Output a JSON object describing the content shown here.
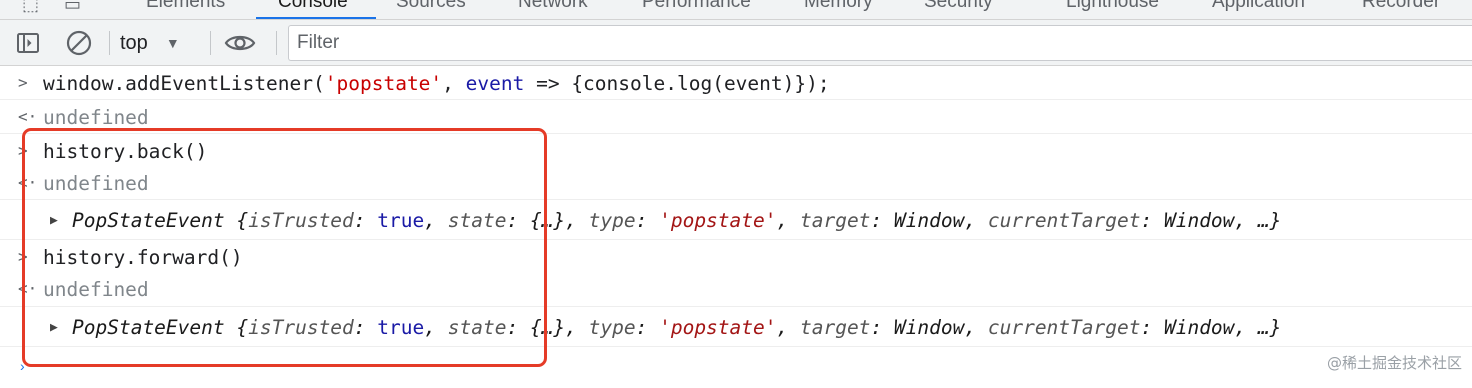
{
  "tabs": [
    {
      "label": "Elements",
      "active": false
    },
    {
      "label": "Console",
      "active": true
    },
    {
      "label": "Sources",
      "active": false
    },
    {
      "label": "Network",
      "active": false
    },
    {
      "label": "Performance",
      "active": false
    },
    {
      "label": "Memory",
      "active": false
    },
    {
      "label": "Security",
      "active": false
    },
    {
      "label": "Lighthouse",
      "active": false
    },
    {
      "label": "Application",
      "active": false
    },
    {
      "label": "Recorder",
      "active": false
    }
  ],
  "toolbar": {
    "context": "top",
    "filter_placeholder": "Filter"
  },
  "console": {
    "cmd1": {
      "code": "window.addEventListener(",
      "str": "'popstate'",
      "comma": ", ",
      "kw": "event",
      "rest": " => {console.log(event)});"
    },
    "result1": "undefined",
    "cmd2": "history.back()",
    "result2": "undefined",
    "event1": {
      "class_name": "PopStateEvent",
      "props": [
        {
          "key": "isTrusted",
          "value": "true",
          "type": "bool"
        },
        {
          "key": "state",
          "value": "{…}",
          "type": "obj"
        },
        {
          "key": "type",
          "value": "'popstate'",
          "type": "str"
        },
        {
          "key": "target",
          "value": "Window",
          "type": "obj"
        },
        {
          "key": "currentTarget",
          "value": "Window",
          "type": "obj"
        }
      ],
      "ellipsis": "…"
    },
    "cmd3": "history.forward()",
    "result3": "undefined",
    "event2": {
      "class_name": "PopStateEvent",
      "props": [
        {
          "key": "isTrusted",
          "value": "true",
          "type": "bool"
        },
        {
          "key": "state",
          "value": "{…}",
          "type": "obj"
        },
        {
          "key": "type",
          "value": "'popstate'",
          "type": "str"
        },
        {
          "key": "target",
          "value": "Window",
          "type": "obj"
        },
        {
          "key": "currentTarget",
          "value": "Window",
          "type": "obj"
        }
      ],
      "ellipsis": "…"
    }
  },
  "watermark": "@稀土掘金技术社区",
  "colors": {
    "highlight_box": "#e53b27",
    "string": "#c80000",
    "keyword": "#1a1aa6",
    "active_tab_underline": "#1a73e8"
  }
}
